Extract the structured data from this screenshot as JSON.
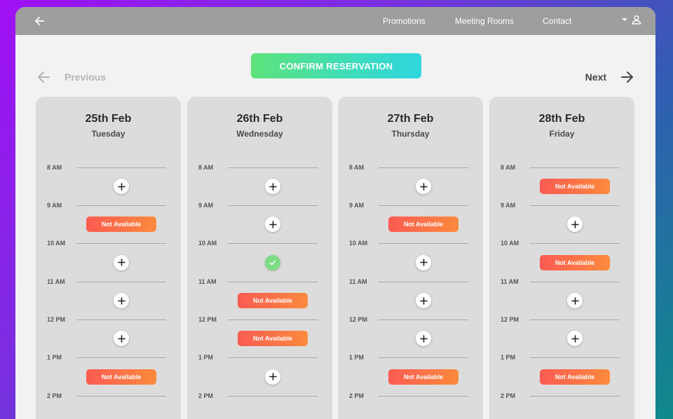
{
  "nav": {
    "links": [
      "Promotions",
      "Meeting Rooms",
      "Contact"
    ]
  },
  "confirm_label": "CONFIRM RESERVATION",
  "pager": {
    "previous": "Previous",
    "next": "Next"
  },
  "time_labels": [
    "8 AM",
    "9 AM",
    "10 AM",
    "11 AM",
    "12 PM",
    "1 PM",
    "2 PM"
  ],
  "days": [
    {
      "date": "25th Feb",
      "weekday": "Tuesday",
      "slots": [
        "add",
        "na",
        "add",
        "add",
        "add",
        "na"
      ]
    },
    {
      "date": "26th Feb",
      "weekday": "Wednesday",
      "slots": [
        "add",
        "add",
        "selected",
        "na",
        "na",
        "add"
      ]
    },
    {
      "date": "27th Feb",
      "weekday": "Thursday",
      "slots": [
        "add",
        "na",
        "add",
        "add",
        "add",
        "na"
      ]
    },
    {
      "date": "28th Feb",
      "weekday": "Friday",
      "slots": [
        "na",
        "add",
        "na",
        "add",
        "add",
        "na"
      ]
    }
  ],
  "not_available_label": "Not Available",
  "colors": {
    "topbar": "#9e9e9e",
    "confirm_gradient": [
      "#5ee27a",
      "#2fd6de"
    ],
    "na_gradient": [
      "#fb5b52",
      "#fd8a3d"
    ],
    "selected": "#7ddc86"
  },
  "icons": {
    "back": "arrow-left-icon",
    "user": "user-icon",
    "caret": "caret-down-icon",
    "prev": "arrow-left-icon",
    "next": "arrow-right-icon",
    "add": "plus-icon",
    "selected": "check-icon"
  }
}
